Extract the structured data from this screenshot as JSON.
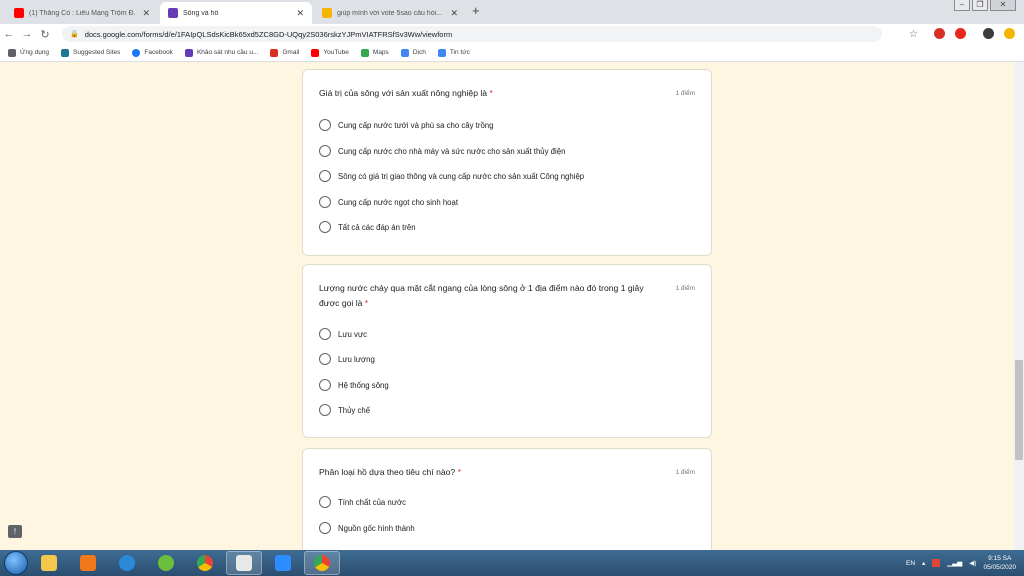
{
  "browser": {
    "tabs": [
      {
        "title": "(1) Thằng Cò : Liêu Mạng Trộm Đ...",
        "favicon": "youtube-icon",
        "color": "#ff0000"
      },
      {
        "title": "Sông và hồ",
        "favicon": "forms-icon",
        "color": "#673ab7"
      },
      {
        "title": "giúp mình với vote 5sao câu hỏi...",
        "favicon": "hoidap-icon",
        "color": "#f4b400"
      }
    ],
    "tab_close": "✕",
    "new_tab": "+",
    "url": "docs.google.com/forms/d/e/1FAIpQLSdsKicBk65xd5ZC8GD-UQqy2S036rskzYJPmVIATFRSfSv3Ww/viewform",
    "bookmarks": [
      {
        "label": "Ứng dụng",
        "icon": "apps-icon",
        "color": "#5f6368"
      },
      {
        "label": "Suggested Sites",
        "icon": "bing-icon",
        "color": "#1a7a94"
      },
      {
        "label": "Facebook",
        "icon": "facebook-icon",
        "color": "#1877f2"
      },
      {
        "label": "Khảo sát nhu cầu u...",
        "icon": "forms-icon",
        "color": "#673ab7"
      },
      {
        "label": "Gmail",
        "icon": "gmail-icon",
        "color": "#d93025"
      },
      {
        "label": "YouTube",
        "icon": "youtube-icon",
        "color": "#ff0000"
      },
      {
        "label": "Maps",
        "icon": "maps-icon",
        "color": "#34a853"
      },
      {
        "label": "Dịch",
        "icon": "translate-icon",
        "color": "#4285f4"
      },
      {
        "label": "Tin tức",
        "icon": "news-icon",
        "color": "#4285f4"
      }
    ]
  },
  "form": {
    "questions": [
      {
        "title": "Giá trị của sông với sản xuất nông nghiệp là",
        "required_mark": "*",
        "points": "1 điểm",
        "options": [
          "Cung cấp nước tưới và phù sa cho cây trồng",
          "Cung cấp nước cho nhà máy và sức nước cho sản xuất thủy điện",
          "Sông có giá trị giao thông và cung cấp nước cho sản xuất Công nghiệp",
          "Cung cấp nước ngọt cho sinh hoạt",
          "Tất cả các đáp án trên"
        ]
      },
      {
        "title": "Lượng nước chảy qua mặt cắt ngang của lòng sông ở 1 địa điểm nào đó trong 1 giây được gọi là",
        "required_mark": "*",
        "points": "1 điểm",
        "options": [
          "Lưu vực",
          "Lưu lượng",
          "Hệ thống sông",
          "Thủy chế"
        ]
      },
      {
        "title": "Phân loại hồ dựa theo tiêu chí nào?",
        "required_mark": "*",
        "points": "1 điểm",
        "options": [
          "Tính chất của nước",
          "Nguồn gốc hình thành"
        ]
      }
    ]
  },
  "taskbar": {
    "language": "EN",
    "time": "9:15 SA",
    "date": "05/05/2020"
  }
}
